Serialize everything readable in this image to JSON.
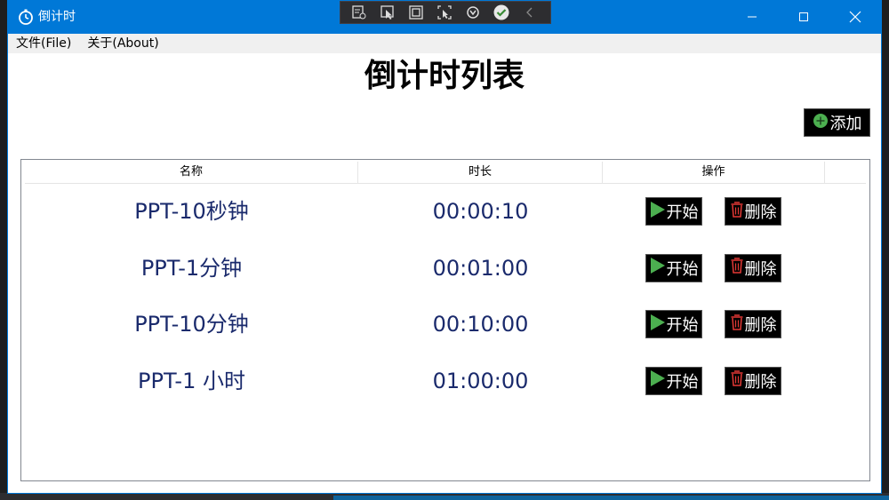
{
  "window": {
    "title": "倒计时"
  },
  "menu": {
    "items": [
      {
        "label": "文件(File)"
      },
      {
        "label": "关于(About)"
      }
    ]
  },
  "page": {
    "title": "倒计时列表",
    "add_label": "添加"
  },
  "table": {
    "headers": [
      "名称",
      "时长",
      "操作"
    ],
    "rows": [
      {
        "name": "PPT-10秒钟",
        "duration": "00:00:10",
        "start_label": "开始",
        "delete_label": "删除"
      },
      {
        "name": "PPT-1分钟",
        "duration": "00:01:00",
        "start_label": "开始",
        "delete_label": "删除"
      },
      {
        "name": "PPT-10分钟",
        "duration": "00:10:00",
        "start_label": "开始",
        "delete_label": "删除"
      },
      {
        "name": "PPT-1 小时",
        "duration": "01:00:00",
        "start_label": "开始",
        "delete_label": "删除"
      }
    ]
  },
  "colors": {
    "titlebar": "#0078d7",
    "accent_green": "#4caf50",
    "delete_red": "#e53935",
    "row_text": "#1a2a6c"
  },
  "icons": {
    "app": "stopwatch-icon",
    "add": "plus-circle-icon",
    "start": "play-icon",
    "delete": "trash-icon"
  }
}
